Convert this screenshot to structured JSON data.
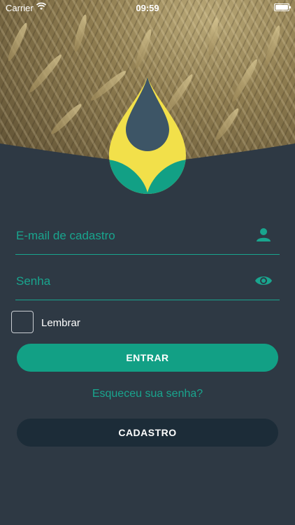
{
  "status_bar": {
    "carrier": "Carrier",
    "time": "09:59"
  },
  "form": {
    "email_placeholder": "E-mail de cadastro",
    "password_placeholder": "Senha",
    "remember_label": "Lembrar",
    "remember_checked": false,
    "login_button": "ENTRAR",
    "forgot_link": "Esqueceu sua senha?",
    "register_button": "CADASTRO"
  },
  "colors": {
    "background": "#2e3944",
    "accent": "#19a58e",
    "primary_button": "#12a085",
    "secondary_button": "#1c2c38"
  },
  "icons": {
    "email_field": "person-icon",
    "password_field": "eye-icon"
  }
}
